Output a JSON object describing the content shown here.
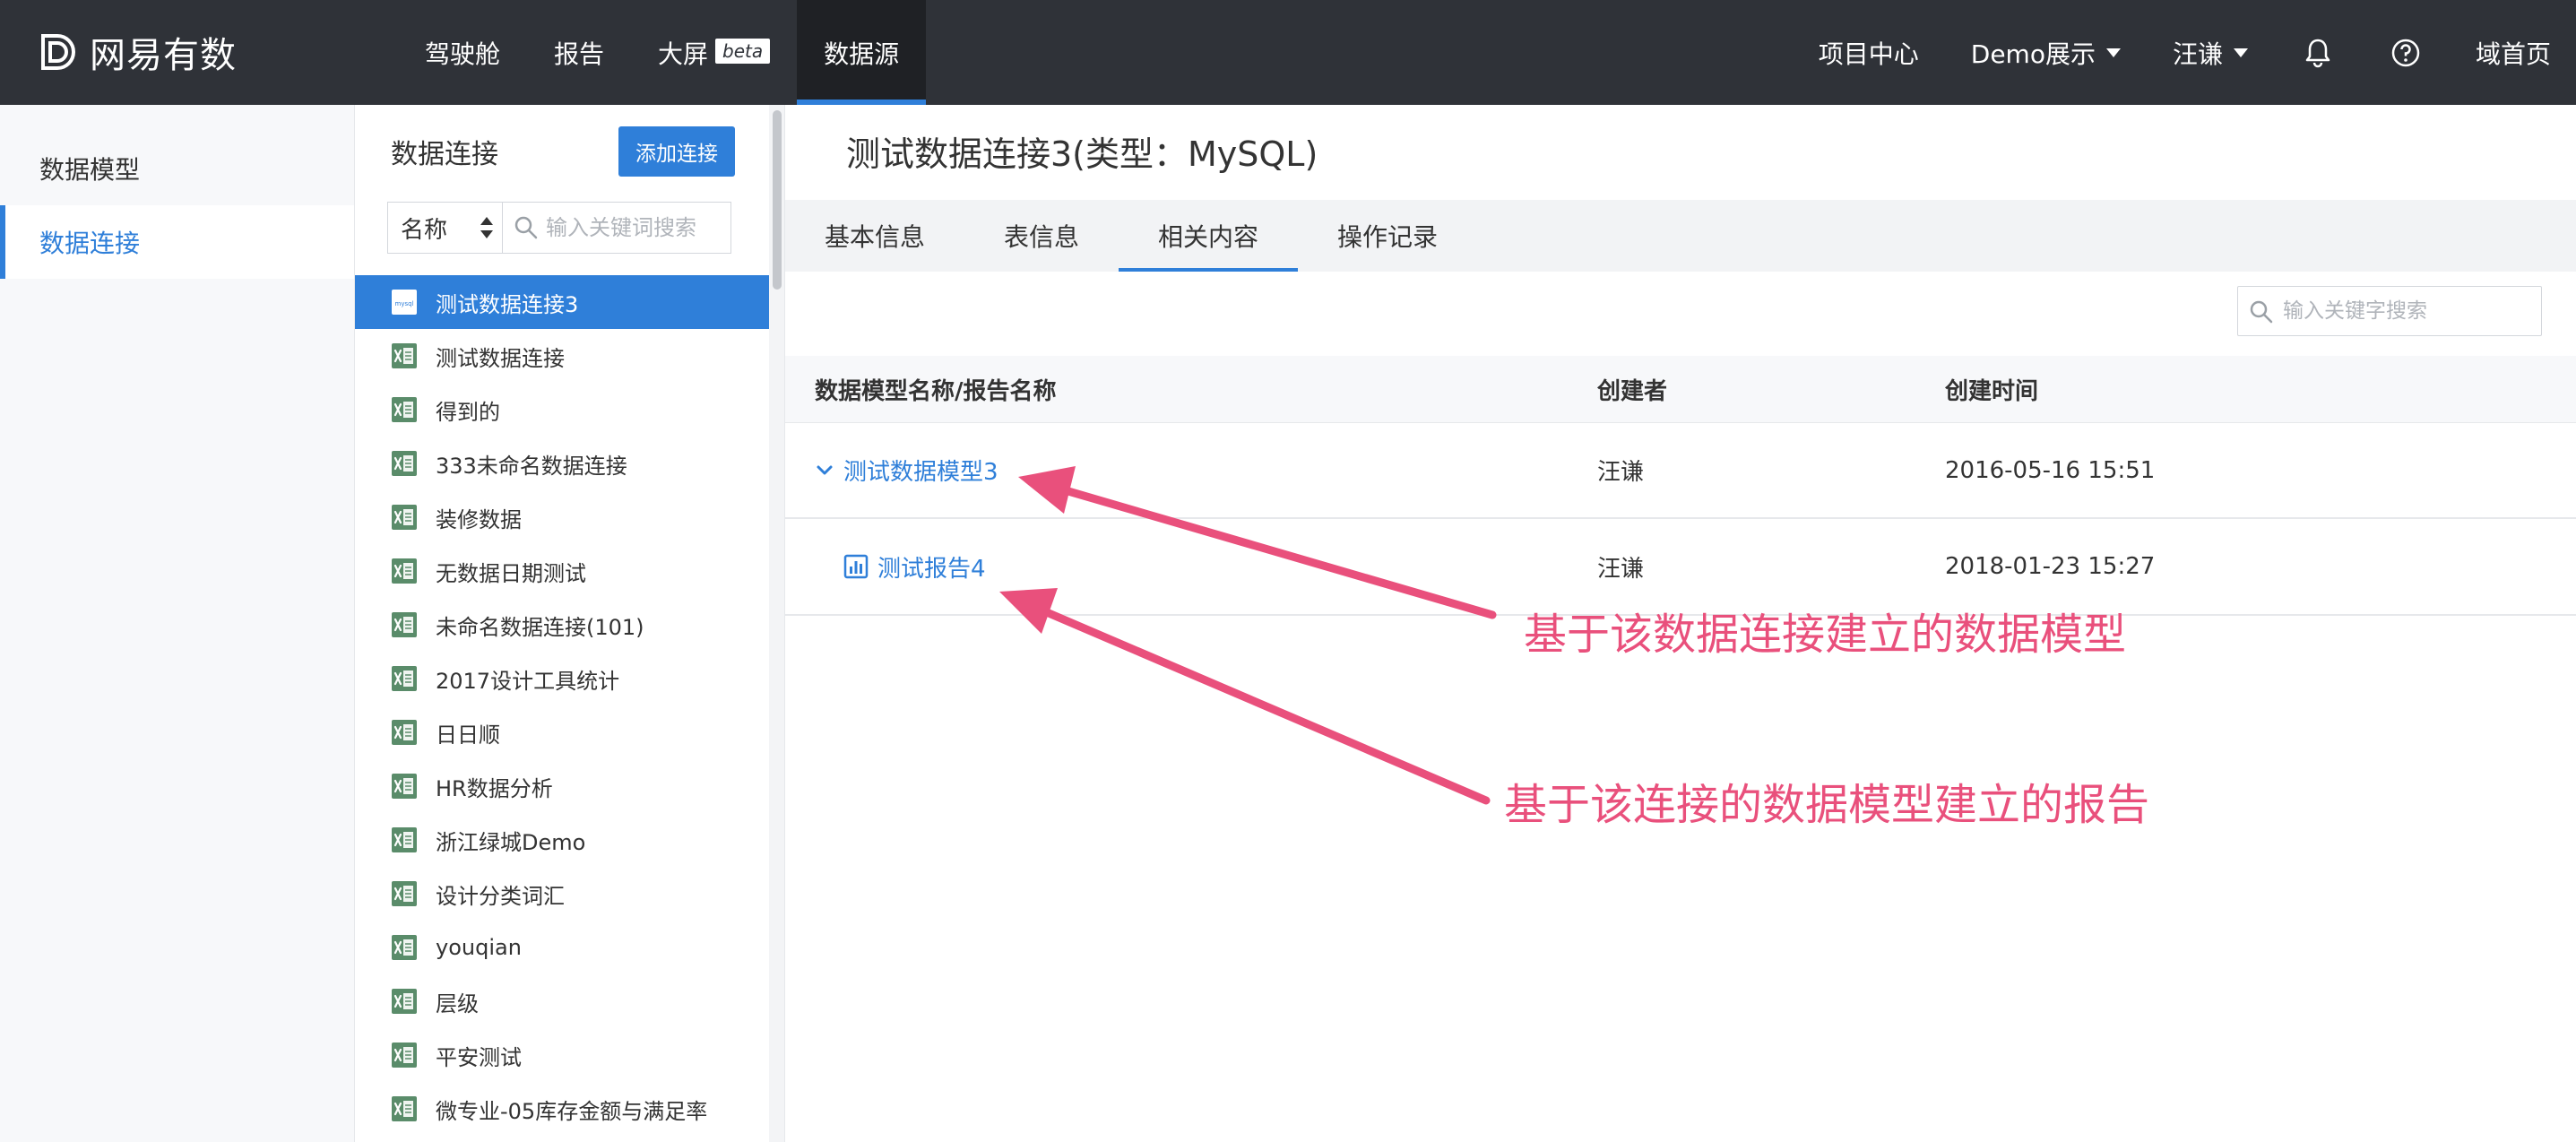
{
  "brand": {
    "name": "网易有数",
    "logo_icon": "youshu-logo-icon"
  },
  "nav": {
    "items": [
      {
        "label": "驾驶舱"
      },
      {
        "label": "报告"
      },
      {
        "label": "大屏",
        "badge": "beta"
      },
      {
        "label": "数据源",
        "active": true
      }
    ]
  },
  "right_nav": {
    "project_center": "项目中心",
    "project": "Demo展示",
    "user": "汪谦",
    "bell_icon": "bell-icon",
    "help_icon": "help-icon",
    "home": "域首页"
  },
  "sidebar": {
    "items": [
      {
        "label": "数据模型"
      },
      {
        "label": "数据连接",
        "active": true
      }
    ]
  },
  "connections": {
    "title": "数据连接",
    "add_button": "添加连接",
    "filter_select": "名称",
    "search_placeholder": "输入关键词搜索",
    "items": [
      {
        "label": "测试数据连接3",
        "icon": "mysql-icon",
        "active": true
      },
      {
        "label": "测试数据连接",
        "icon": "excel-icon"
      },
      {
        "label": "得到的",
        "icon": "excel-icon"
      },
      {
        "label": "333未命名数据连接",
        "icon": "excel-icon"
      },
      {
        "label": "装修数据",
        "icon": "excel-icon"
      },
      {
        "label": "无数据日期测试",
        "icon": "excel-icon"
      },
      {
        "label": "未命名数据连接(101)",
        "icon": "excel-icon"
      },
      {
        "label": "2017设计工具统计",
        "icon": "excel-icon"
      },
      {
        "label": "日日顺",
        "icon": "excel-icon"
      },
      {
        "label": "HR数据分析",
        "icon": "excel-icon"
      },
      {
        "label": "浙江绿城Demo",
        "icon": "excel-icon"
      },
      {
        "label": "设计分类词汇",
        "icon": "excel-icon"
      },
      {
        "label": "youqian",
        "icon": "excel-icon"
      },
      {
        "label": "层级",
        "icon": "excel-icon"
      },
      {
        "label": "平安测试",
        "icon": "excel-icon"
      },
      {
        "label": "微专业-05库存金额与满足率",
        "icon": "excel-icon"
      }
    ]
  },
  "detail": {
    "title": "测试数据连接3(类型：MySQL)",
    "tabs": [
      {
        "label": "基本信息"
      },
      {
        "label": "表信息"
      },
      {
        "label": "相关内容",
        "active": true
      },
      {
        "label": "操作记录"
      }
    ],
    "search_placeholder": "输入关键字搜索",
    "table": {
      "headers": [
        "数据模型名称/报告名称",
        "创建者",
        "创建时间"
      ],
      "rows": [
        {
          "name": "测试数据模型3",
          "creator": "汪谦",
          "created": "2016-05-16 15:51",
          "kind": "model",
          "expanded": true
        },
        {
          "name": "测试报告4",
          "creator": "汪谦",
          "created": "2018-01-23 15:27",
          "kind": "report"
        }
      ]
    }
  },
  "annotations": {
    "model_note": "基于该数据连接建立的数据模型",
    "report_note": "基于该连接的数据模型建立的报告",
    "color": "#e9507c"
  },
  "colors": {
    "topbar": "#2f3238",
    "accent": "#2f7fd9",
    "excel": "#5a8c6a"
  }
}
